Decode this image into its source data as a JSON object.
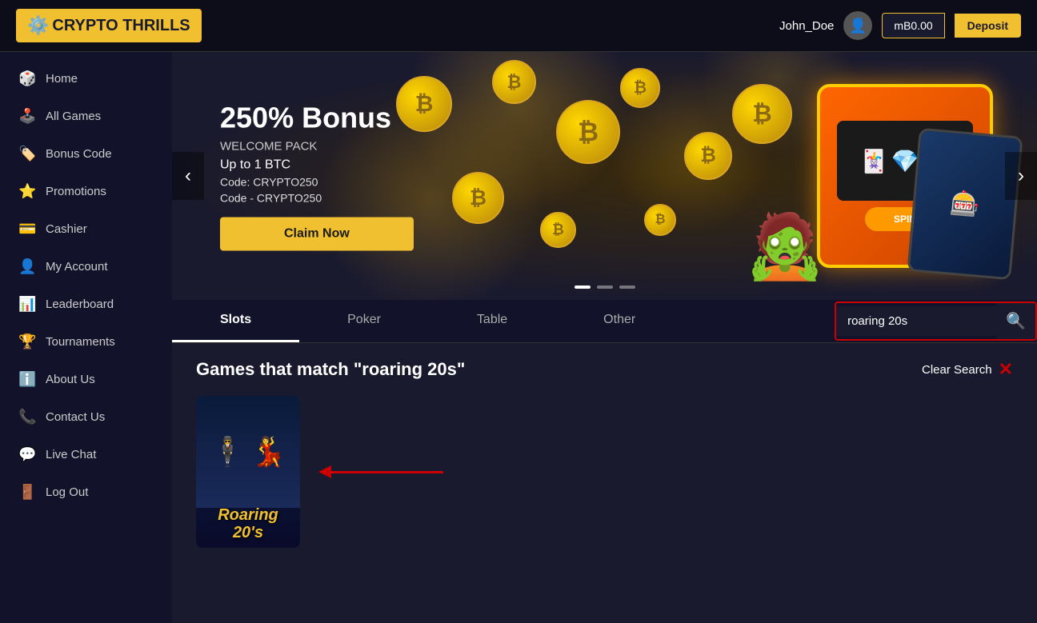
{
  "header": {
    "logo_text": "CRYPTO THRILLS",
    "logo_icon": "🎰",
    "username": "John_Doe",
    "balance": "mB0.00",
    "deposit_label": "Deposit"
  },
  "sidebar": {
    "items": [
      {
        "id": "home",
        "label": "Home",
        "icon": "🎲"
      },
      {
        "id": "all-games",
        "label": "All Games",
        "icon": "🕹️"
      },
      {
        "id": "bonus-code",
        "label": "Bonus Code",
        "icon": "🏷️"
      },
      {
        "id": "promotions",
        "label": "Promotions",
        "icon": "⭐"
      },
      {
        "id": "cashier",
        "label": "Cashier",
        "icon": "💳"
      },
      {
        "id": "my-account",
        "label": "My Account",
        "icon": "👤"
      },
      {
        "id": "leaderboard",
        "label": "Leaderboard",
        "icon": "📊"
      },
      {
        "id": "tournaments",
        "label": "Tournaments",
        "icon": "🏆"
      },
      {
        "id": "about-us",
        "label": "About Us",
        "icon": "ℹ️"
      },
      {
        "id": "contact-us",
        "label": "Contact Us",
        "icon": "📞"
      },
      {
        "id": "live-chat",
        "label": "Live Chat",
        "icon": "💬"
      },
      {
        "id": "log-out",
        "label": "Log Out",
        "icon": "🚪"
      }
    ]
  },
  "banner": {
    "bonus_title": "250% Bonus",
    "welcome_pack": "WELCOME PACK",
    "btc_amount": "Up to 1 BTC",
    "code_line1": "Code: CRYPTO250",
    "code_line2": "Code - CRYPTO250",
    "claim_label": "Claim Now"
  },
  "game_tabs": {
    "tabs": [
      {
        "id": "slots",
        "label": "Slots",
        "active": true
      },
      {
        "id": "poker",
        "label": "Poker",
        "active": false
      },
      {
        "id": "table",
        "label": "Table",
        "active": false
      },
      {
        "id": "other",
        "label": "Other",
        "active": false
      }
    ],
    "search_placeholder": "roaring 20s",
    "search_value": "roaring 20s"
  },
  "games_section": {
    "title": "Games that match \"roaring 20s\"",
    "clear_search_label": "Clear Search",
    "games": [
      {
        "id": "roaring-20s",
        "title": "Roaring 20s",
        "title_line1": "Roaring",
        "title_line2": "20s"
      }
    ]
  }
}
